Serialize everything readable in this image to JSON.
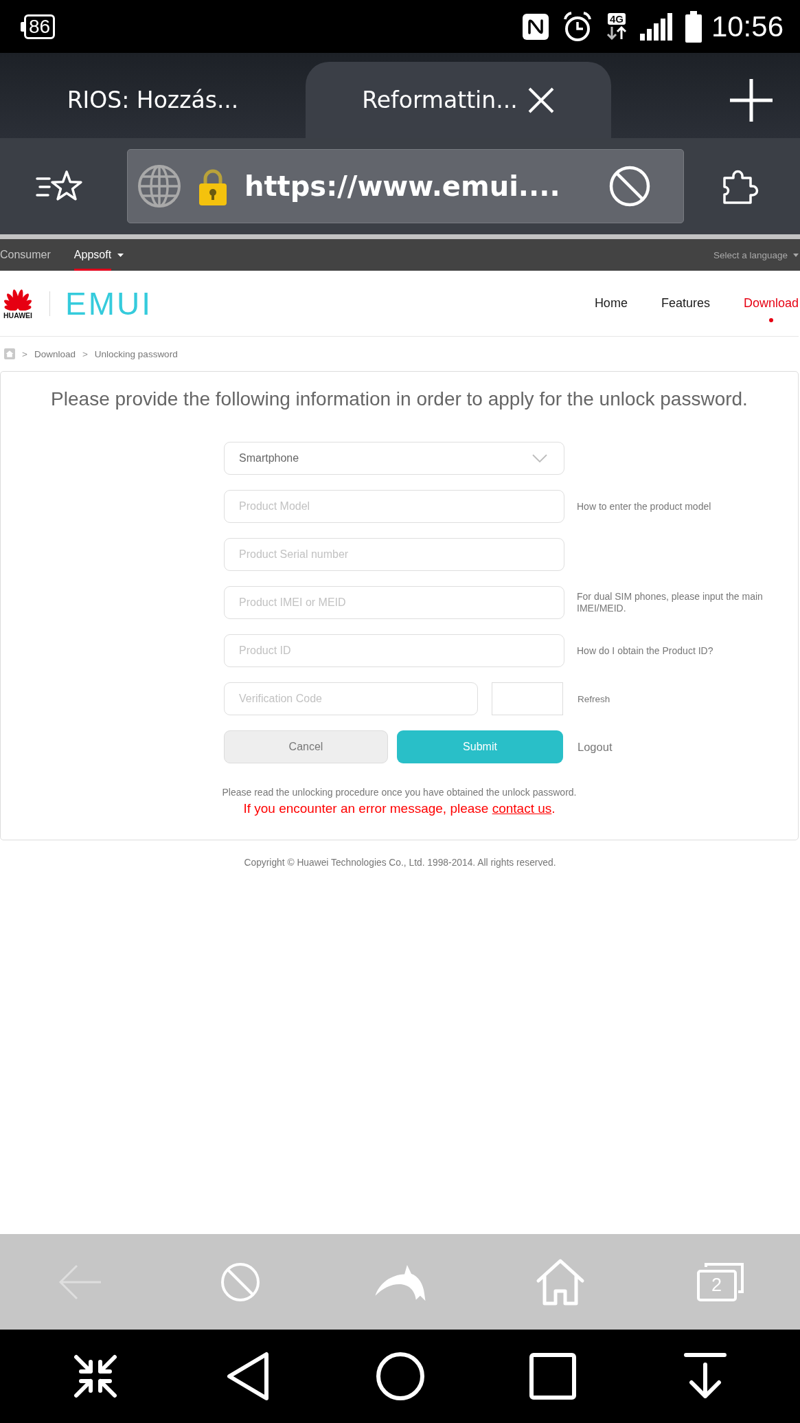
{
  "status_bar": {
    "battery": "86",
    "network": "4G",
    "time": "10:56"
  },
  "browser_tabs": [
    {
      "title": "RIOS: Hozzás...",
      "selected": false
    },
    {
      "title": "Reformattin...",
      "selected": true
    }
  ],
  "address_bar": {
    "url": "https://www.emui...."
  },
  "site_nav": {
    "items": [
      {
        "label": "Consumer",
        "selected": false,
        "has_menu": false
      },
      {
        "label": "Appsoft",
        "selected": true,
        "has_menu": true
      }
    ],
    "language": "Select a language"
  },
  "header": {
    "brand": "HUAWEI",
    "logo": "EMUI",
    "nav": [
      {
        "label": "Home",
        "selected": false
      },
      {
        "label": "Features",
        "selected": false
      },
      {
        "label": "Download",
        "selected": true
      }
    ]
  },
  "breadcrumb": {
    "separator": ">",
    "items": [
      "Download",
      "Unlocking password"
    ]
  },
  "form": {
    "heading": "Please provide the following information in order to apply for the unlock password.",
    "select": {
      "value": "Smartphone"
    },
    "fields": [
      {
        "kind": "text",
        "placeholder": "Product Model",
        "hint": "How to enter the product model"
      },
      {
        "kind": "text",
        "placeholder": "Product Serial number"
      },
      {
        "kind": "text",
        "placeholder": "Product IMEI or MEID",
        "hint": "For dual SIM phones, please input the main IMEI/MEID."
      },
      {
        "kind": "text",
        "placeholder": "Product ID",
        "hint": "How do I obtain the Product ID?"
      },
      {
        "kind": "captcha",
        "placeholder": "Verification Code",
        "hint": "Refresh"
      }
    ],
    "buttons": [
      {
        "label": "Cancel",
        "kind": "secondary"
      },
      {
        "label": "Submit",
        "kind": "primary"
      },
      {
        "label": "Logout",
        "kind": "link"
      }
    ],
    "note": "Please read the unlocking procedure once you have obtained the unlock password.",
    "error_note": {
      "before": "If you encounter an error message, please ",
      "link": "contact us",
      "after": "."
    }
  },
  "copyright": "Copyright © Huawei Technologies Co., Ltd. 1998-2014. All rights reserved.",
  "browser_toolbar": [
    {
      "kind": "back",
      "disabled": true
    },
    {
      "kind": "stop",
      "disabled": false
    },
    {
      "kind": "dolphin",
      "disabled": false
    },
    {
      "kind": "home",
      "disabled": false
    },
    {
      "kind": "tabs",
      "disabled": false,
      "count": "2"
    }
  ]
}
